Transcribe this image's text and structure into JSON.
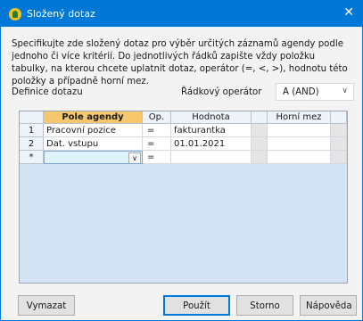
{
  "window": {
    "title": "Složený dotaz",
    "close_glyph": "✕",
    "icon": "app-logo-icon"
  },
  "description": "Specifikujte zde složený dotaz pro výběr určitých záznamů agendy podle jednoho či více kritérií. Do jednotlivých řádků zapište vždy položku tabulky, na kterou chcete uplatnit dotaz, operátor (=, <, >), hodnotu této položky a případně horní mez.",
  "definition_label": "Definice dotazu",
  "row_operator": {
    "label": "Řádkový operátor",
    "value": "A (AND)"
  },
  "grid": {
    "columns": [
      "Pole agendy",
      "Op.",
      "Hodnota",
      "",
      "Horní mez",
      ""
    ],
    "rows": [
      {
        "num": "1",
        "field": "Pracovní pozice",
        "op": "=",
        "value": "fakturantka",
        "upper": ""
      },
      {
        "num": "2",
        "field": "Dat. vstupu",
        "op": "=",
        "value": "01.01.2021",
        "upper": ""
      }
    ],
    "new_row": {
      "marker": "*",
      "field": "",
      "op": "="
    }
  },
  "buttons": {
    "clear": "Vymazat",
    "apply": "Použít",
    "cancel": "Storno",
    "help": "Nápověda"
  },
  "colors": {
    "titlebar": "#0078d7",
    "active_header": "#f6c76d",
    "grid_background": "#d3e3f4"
  }
}
